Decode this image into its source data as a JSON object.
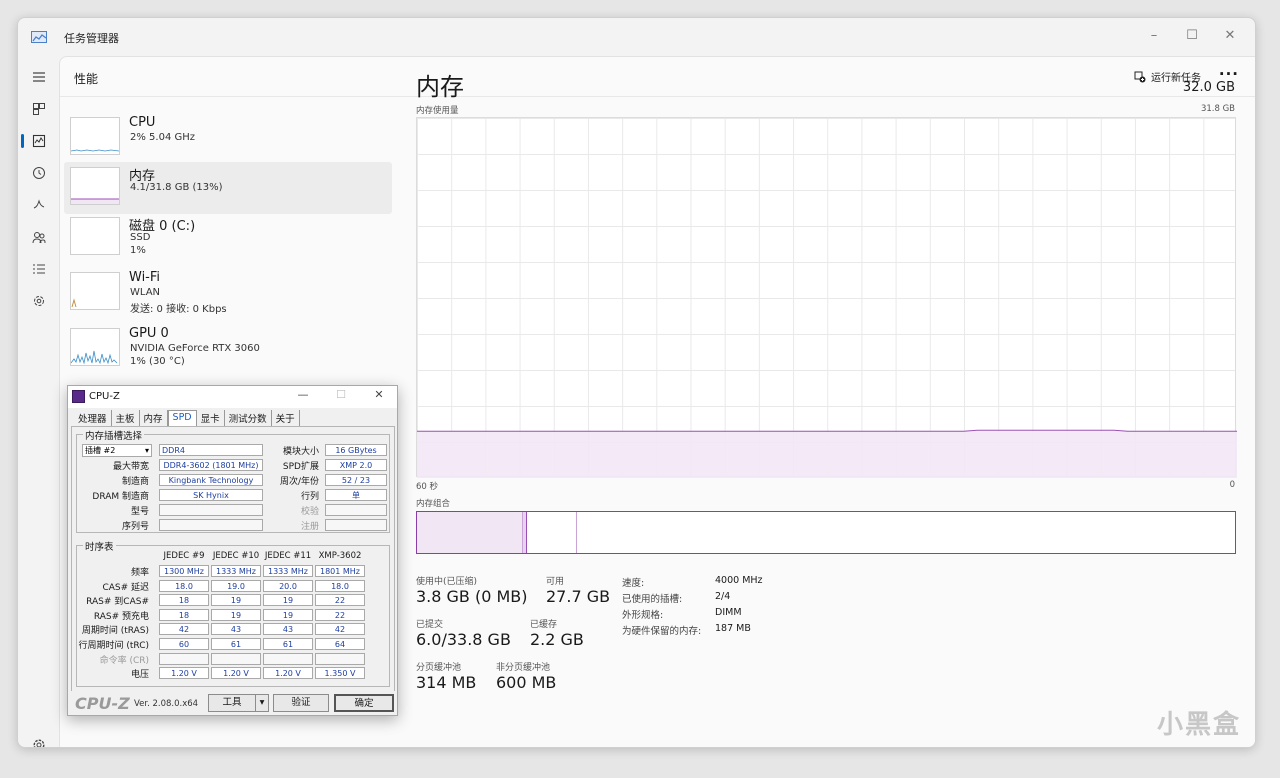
{
  "taskmgr": {
    "title": "任务管理器",
    "page_title": "性能",
    "run_task_label": "运行新任务",
    "more_label": "···",
    "window_buttons": {
      "minimize": "–",
      "maximize": "☐",
      "close": "✕"
    }
  },
  "devices": [
    {
      "name": "CPU",
      "sub1": "2% 5.04 GHz",
      "sub2": "",
      "sub3": ""
    },
    {
      "name": "内存",
      "sub1": "4.1/31.8 GB (13%)",
      "sub2": "",
      "sub3": ""
    },
    {
      "name": "磁盘 0 (C:)",
      "sub1": "SSD",
      "sub2": "1%",
      "sub3": ""
    },
    {
      "name": "Wi-Fi",
      "sub1": "WLAN",
      "sub2": "发送: 0 接收: 0 Kbps",
      "sub3": ""
    },
    {
      "name": "GPU 0",
      "sub1": "NVIDIA GeForce RTX 3060",
      "sub2": "1% (30 °C)",
      "sub3": ""
    }
  ],
  "memory": {
    "heading": "内存",
    "total": "32.0 GB",
    "usage_label": "内存使用量",
    "usage_max": "31.8 GB",
    "axis_left": "60 秒",
    "axis_right": "0",
    "composition_label": "内存组合",
    "usage_fraction": 0.13,
    "composition": {
      "in_use_fraction": 0.13,
      "modified_fraction": 0.005,
      "standby_fraction": 0.06
    },
    "stats": {
      "in_use_label": "使用中(已压缩)",
      "in_use_value": "3.8 GB (0 MB)",
      "available_label": "可用",
      "available_value": "27.7 GB",
      "committed_label": "已提交",
      "committed_value": "6.0/33.8 GB",
      "cached_label": "已缓存",
      "cached_value": "2.2 GB",
      "paged_label": "分页缓冲池",
      "paged_value": "314 MB",
      "nonpaged_label": "非分页缓冲池",
      "nonpaged_value": "600 MB"
    },
    "details": [
      {
        "k": "速度:",
        "v": "4000 MHz"
      },
      {
        "k": "已使用的插槽:",
        "v": "2/4"
      },
      {
        "k": "外形规格:",
        "v": "DIMM"
      },
      {
        "k": "为硬件保留的内存:",
        "v": "187 MB"
      }
    ]
  },
  "watermark": "小黑盒",
  "cpuz": {
    "title": "CPU-Z",
    "window_buttons": {
      "minimize": "—",
      "maximize": "☐",
      "close": "✕"
    },
    "tabs": [
      "处理器",
      "主板",
      "内存",
      "SPD",
      "显卡",
      "测试分数",
      "关于"
    ],
    "active_tab": "SPD",
    "slot_group_title": "内存插槽选择",
    "slot_select": "插槽 #2",
    "mem_type": "DDR4",
    "labels": {
      "module_size": "模块大小",
      "max_bandwidth": "最大带宽",
      "spd_ext": "SPD扩展",
      "manufacturer": "制造商",
      "week_year": "周次/年份",
      "dram_mfr": "DRAM 制造商",
      "ranks": "行列",
      "part_number": "型号",
      "correction": "校验",
      "serial": "序列号",
      "registered": "注册"
    },
    "values": {
      "module_size": "16 GBytes",
      "max_bandwidth": "DDR4-3602 (1801 MHz)",
      "spd_ext": "XMP 2.0",
      "manufacturer": "Kingbank Technology",
      "week_year": "52 / 23",
      "dram_mfr": "SK Hynix",
      "ranks": "单"
    },
    "timing_group_title": "时序表",
    "timing_columns": [
      "JEDEC #9",
      "JEDEC #10",
      "JEDEC #11",
      "XMP-3602"
    ],
    "timing_rows": [
      {
        "label": "频率",
        "values": [
          "1300 MHz",
          "1333 MHz",
          "1333 MHz",
          "1801 MHz"
        ],
        "dim": false
      },
      {
        "label": "CAS# 延迟",
        "values": [
          "18.0",
          "19.0",
          "20.0",
          "18.0"
        ],
        "dim": false
      },
      {
        "label": "RAS# 到CAS#",
        "values": [
          "18",
          "19",
          "19",
          "22"
        ],
        "dim": false
      },
      {
        "label": "RAS# 预充电",
        "values": [
          "18",
          "19",
          "19",
          "22"
        ],
        "dim": false
      },
      {
        "label": "周期时间 (tRAS)",
        "values": [
          "42",
          "43",
          "43",
          "42"
        ],
        "dim": false
      },
      {
        "label": "行周期时间 (tRC)",
        "values": [
          "60",
          "61",
          "61",
          "64"
        ],
        "dim": false
      },
      {
        "label": "命令率 (CR)",
        "values": [
          "",
          "",
          "",
          ""
        ],
        "dim": true
      },
      {
        "label": "电压",
        "values": [
          "1.20 V",
          "1.20 V",
          "1.20 V",
          "1.350 V"
        ],
        "dim": false
      }
    ],
    "logo": "CPU-Z",
    "version": "Ver. 2.08.0.x64",
    "tools_btn": "工具",
    "validate_btn": "验证",
    "ok_btn": "确定"
  }
}
